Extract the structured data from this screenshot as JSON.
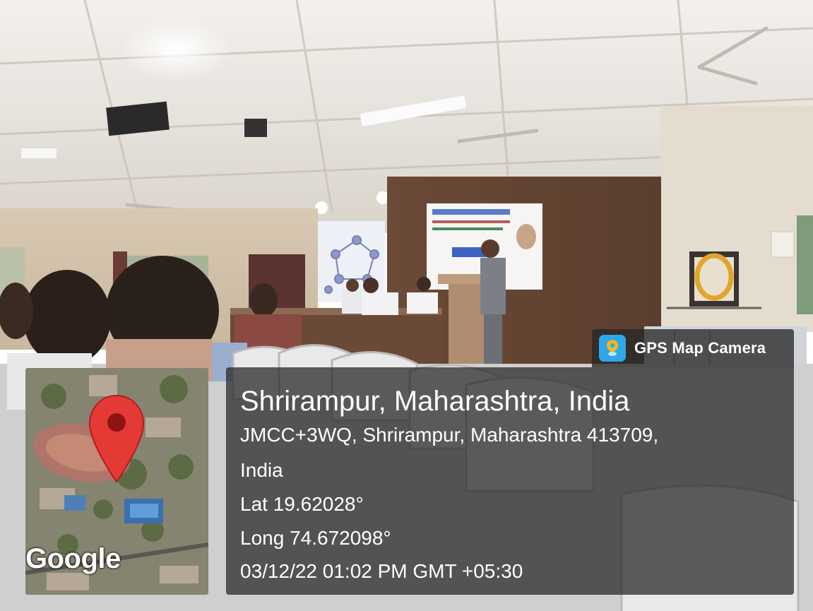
{
  "overlay": {
    "app_name": "GPS Map Camera",
    "app_icon": "gps-map-camera-icon",
    "map_logo": "Google",
    "location_title": "Shrirampur, Maharashtra, India",
    "address_line1": "JMCC+3WQ, Shrirampur, Maharashtra 413709,",
    "address_line2": "India",
    "latitude": "Lat 19.62028°",
    "longitude": "Long 74.672098°",
    "datetime": "03/12/22 01:02 PM GMT +05:30"
  },
  "colors": {
    "map_pin": "#e53935",
    "panel_bg": "#232323",
    "app_icon_bg": "#2fa7e8"
  }
}
